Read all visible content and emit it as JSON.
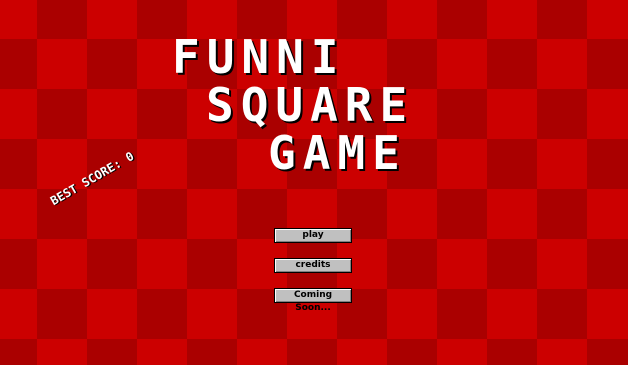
{
  "title": {
    "line1": "FUNNI",
    "line2": "SQUARE",
    "line3": "GAME"
  },
  "best_score": {
    "label": "BEST SCORE:",
    "value": "0"
  },
  "menu": {
    "play_label": "play",
    "credits_label": "credits",
    "coming_soon_label": "Coming Soon..."
  },
  "colors": {
    "checker_light": "#cc0000",
    "checker_dark": "#aa0000",
    "title_text": "#ffffff",
    "button_face": "#c0c0c0"
  }
}
